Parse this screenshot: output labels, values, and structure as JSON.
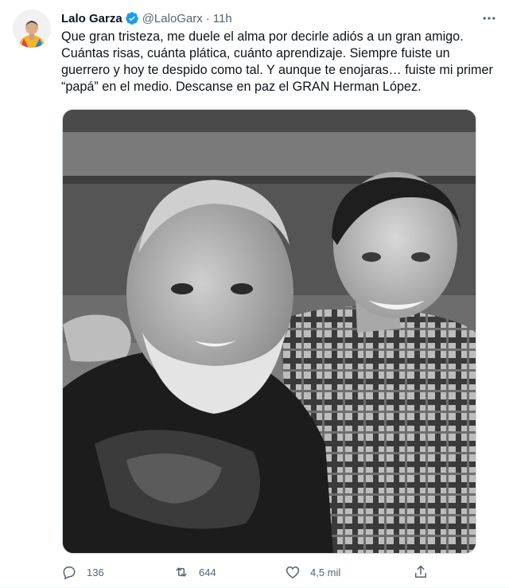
{
  "tweet": {
    "author": {
      "display_name": "Lalo Garza",
      "handle": "@LaloGarx",
      "verified": true
    },
    "separator": "·",
    "time": "11h",
    "text": "Que gran tristeza, me duele el alma por decirle adiós a un gran amigo.\nCuántas risas, cuánta plática, cuánto aprendizaje. Siempre fuiste un\nguerrero y hoy te despido como tal. Y aunque te enojaras… fuiste mi primer\n“papá” en el medio. Descanse en paz el GRAN Herman López.",
    "stats": {
      "replies": "136",
      "retweets": "644",
      "likes": "4,5 mil"
    }
  },
  "icons": {
    "verified": "verified-badge-icon",
    "more": "more-dots-icon",
    "reply": "reply-bubble-icon",
    "retweet": "retweet-icon",
    "like": "heart-icon",
    "share": "share-icon"
  },
  "colors": {
    "text_primary": "#0f1419",
    "text_secondary": "#536471",
    "verified_blue": "#1d9bf0",
    "border": "#cfd9de"
  }
}
